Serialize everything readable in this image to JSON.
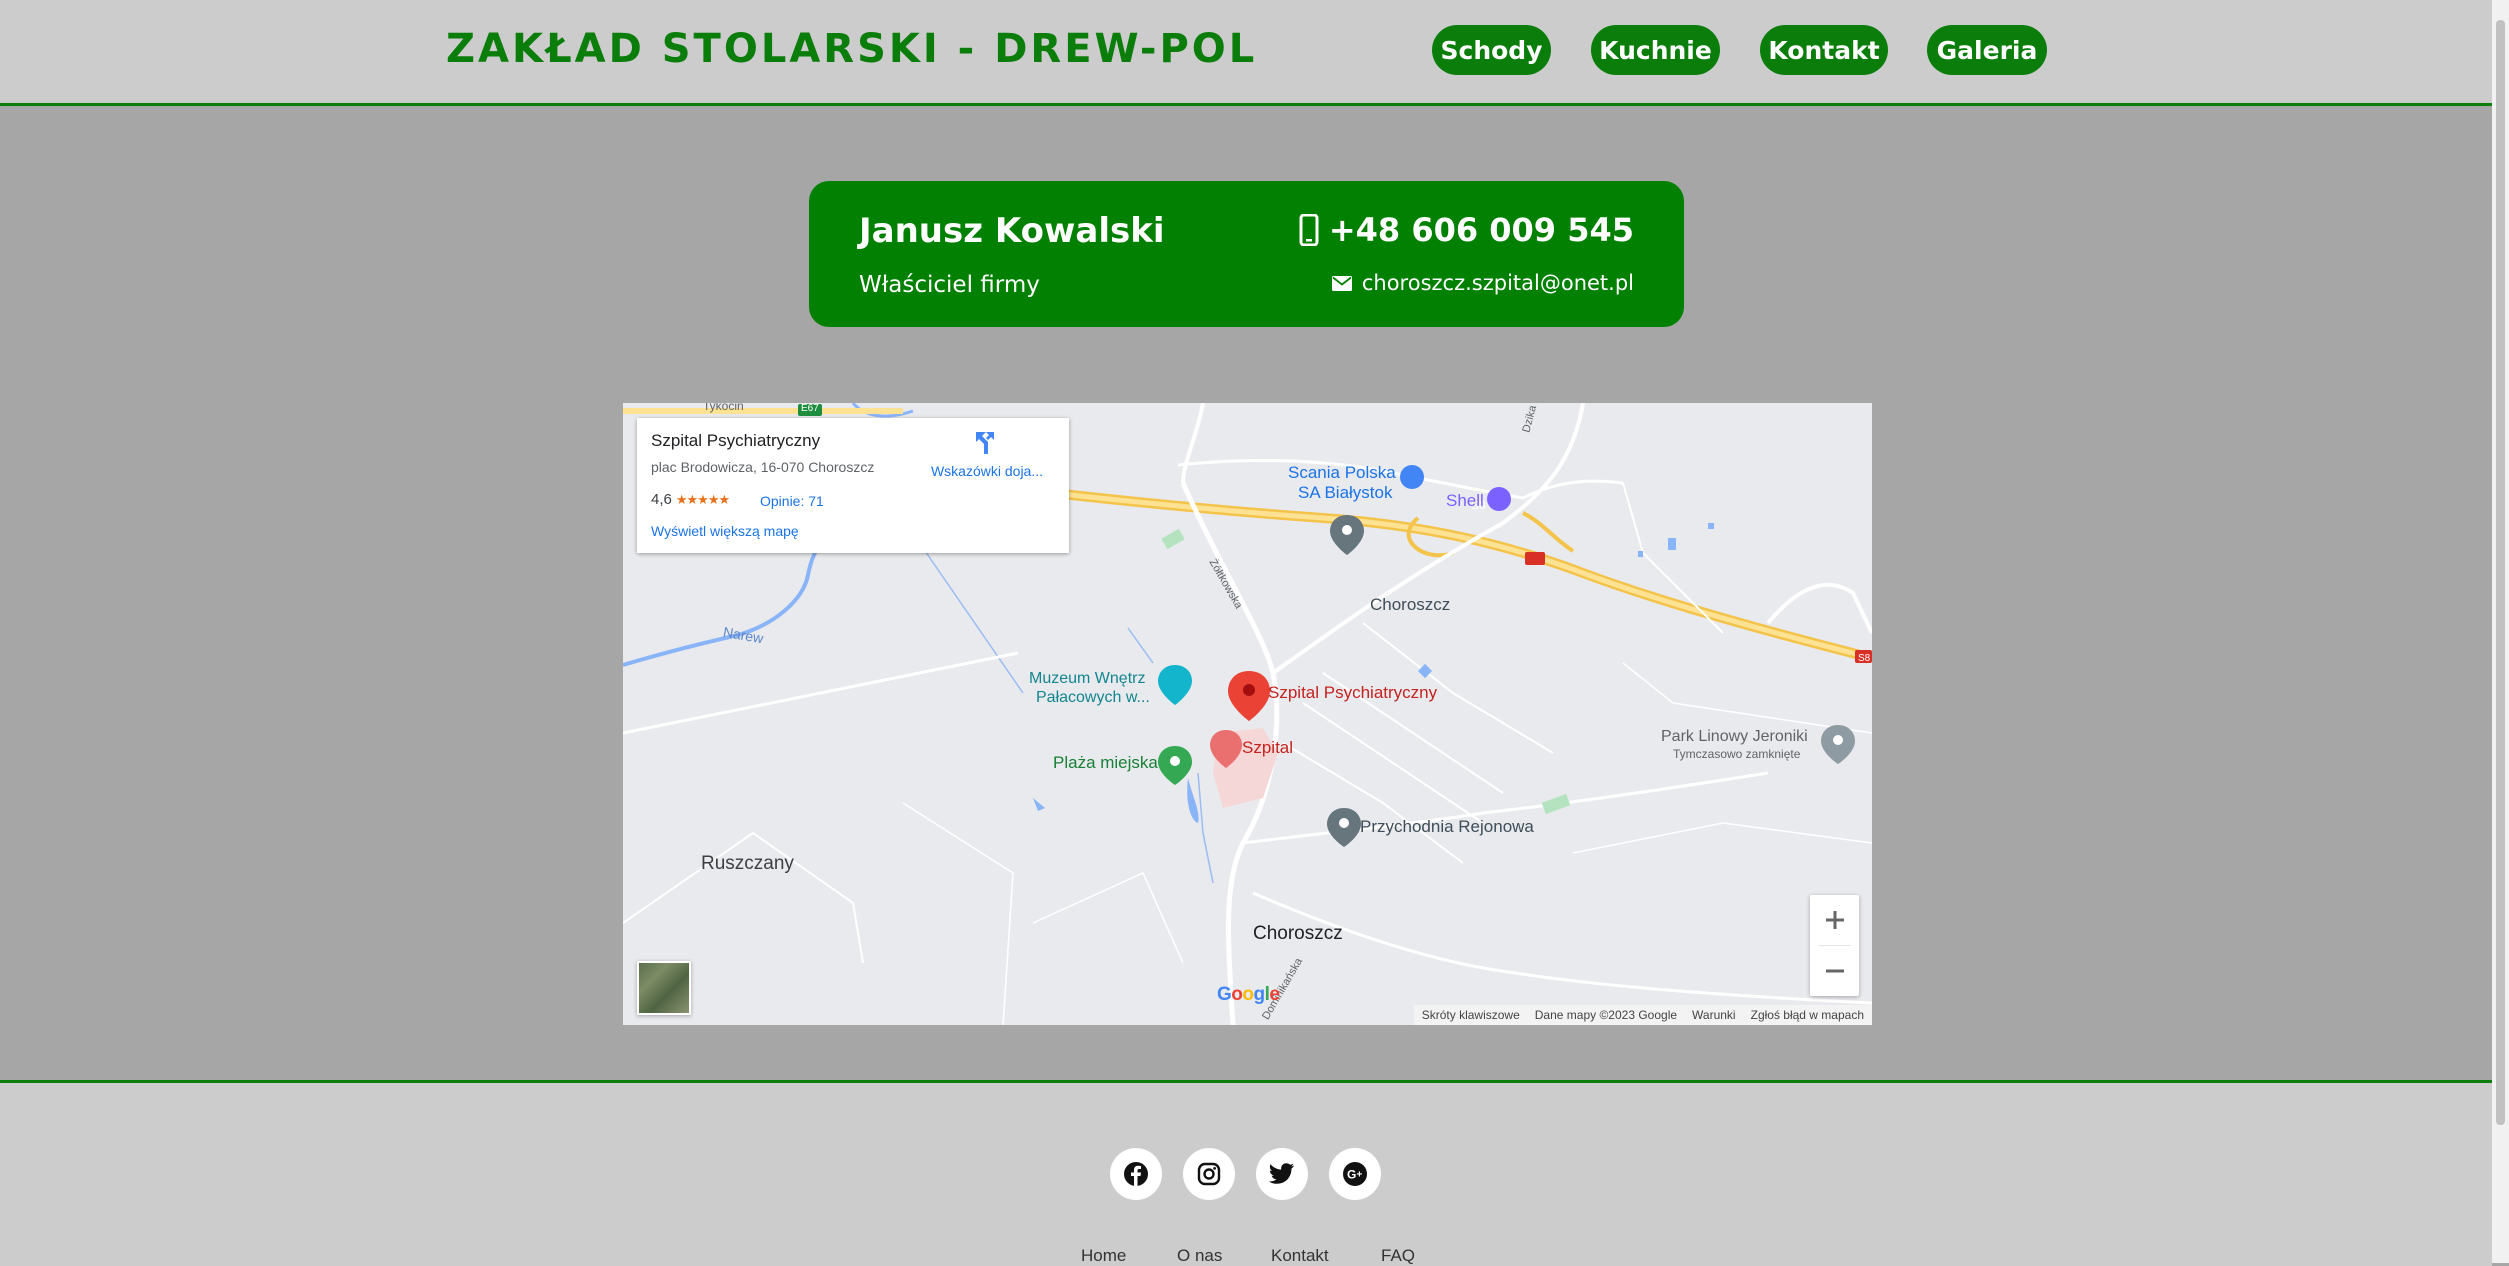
{
  "header": {
    "brand": "ZAKŁAD STOLARSKI - DREW-POL",
    "nav": [
      "Schody",
      "Kuchnie",
      "Kontakt",
      "Galeria"
    ]
  },
  "contact": {
    "name": "Janusz Kowalski",
    "role": "Właściciel firmy",
    "phone": "+48 606 009 545",
    "email": "choroszcz.szpital@onet.pl"
  },
  "map": {
    "infocard": {
      "title": "Szpital Psychiatryczny",
      "address": "plac Brodowicza, 16-070 Choroszcz",
      "rating": "4,6",
      "reviews": "Opinie: 71",
      "larger_map": "Wyświetl większą mapę",
      "directions": "Wskazówki doja..."
    },
    "labels": {
      "scania": "Scania Polska",
      "scania2": "SA Białystok",
      "shell": "Shell",
      "choroszcz_pin": "Choroszcz",
      "muzeum1": "Muzeum Wnętrz",
      "muzeum2": "Pałacowych w...",
      "szpital_psych": "Szpital Psychiatryczny",
      "szpital": "Szpital",
      "plaza": "Plaża miejska",
      "park1": "Park Linowy Jeroniki",
      "park2": "Tymczasowo zamknięte",
      "przychodnia": "Przychodnia Rejonowa",
      "ruszczany": "Ruszczany",
      "choroszcz_town": "Choroszcz",
      "narew": "Narew",
      "zoltkowska": "Żółtkowska",
      "dzika": "Dzika",
      "dominikanska": "Dominikańska",
      "tykocin": "Tykocin",
      "s8": "S8",
      "s8b": "S8",
      "e67": "E67"
    },
    "attribution": [
      "Skróty klawiszowe",
      "Dane mapy ©2023 Google",
      "Warunki",
      "Zgłoś błąd w mapach"
    ],
    "zoom_in": "+",
    "zoom_out": "−",
    "google": "Google"
  },
  "footer": {
    "social": [
      "facebook-icon",
      "instagram-icon",
      "twitter-icon",
      "google-plus-icon"
    ],
    "links": [
      "Home",
      "O nas",
      "Kontakt",
      "FAQ"
    ]
  },
  "colors": {
    "green": "#0a7d0a",
    "card_green": "#018001",
    "page_bg": "#a6a6a6",
    "bar_bg": "#cccccc"
  }
}
